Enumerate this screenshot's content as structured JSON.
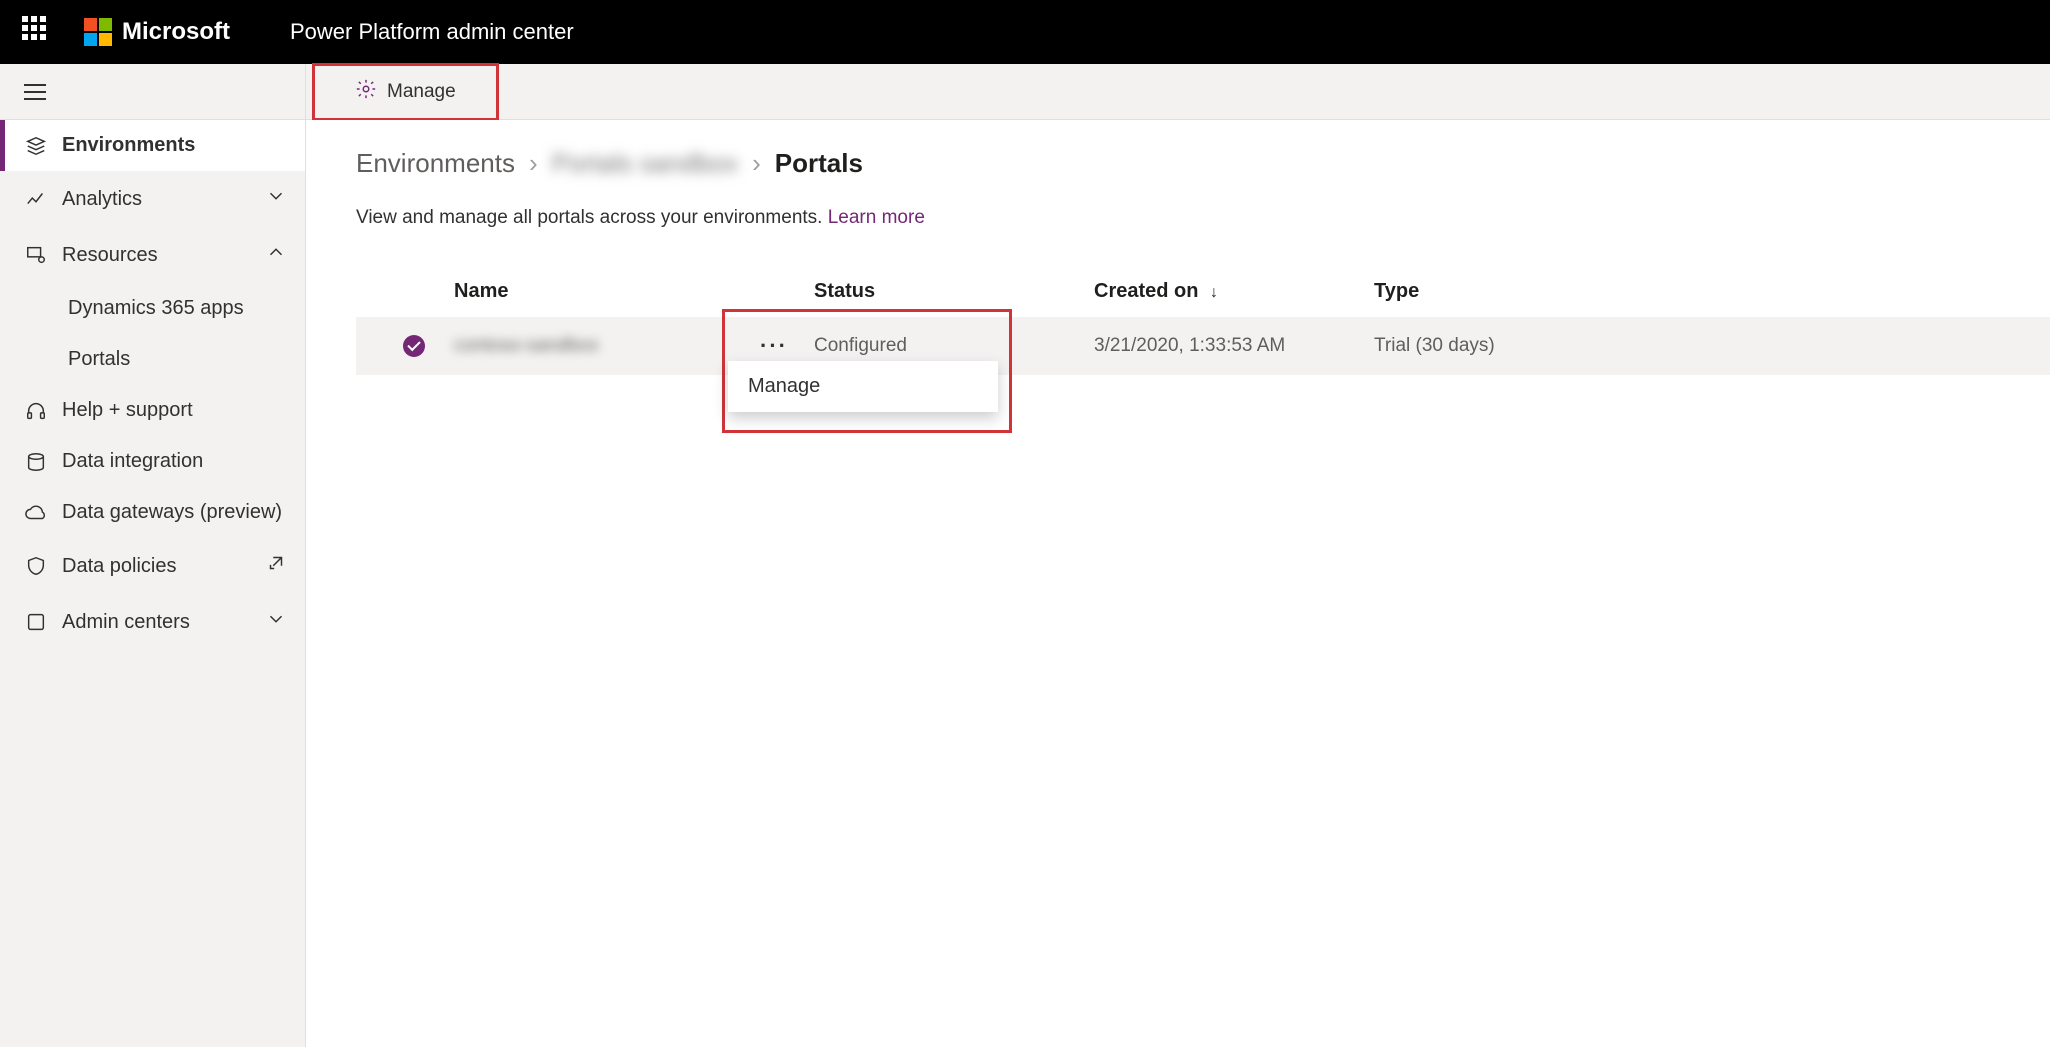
{
  "topbar": {
    "brand": "Microsoft",
    "app_title": "Power Platform admin center"
  },
  "sidebar": {
    "items": [
      {
        "label": "Environments"
      },
      {
        "label": "Analytics"
      },
      {
        "label": "Resources"
      },
      {
        "label": "Dynamics 365 apps"
      },
      {
        "label": "Portals"
      },
      {
        "label": "Help + support"
      },
      {
        "label": "Data integration"
      },
      {
        "label": "Data gateways (preview)"
      },
      {
        "label": "Data policies"
      },
      {
        "label": "Admin centers"
      }
    ]
  },
  "commandbar": {
    "manage": "Manage"
  },
  "breadcrumb": {
    "root": "Environments",
    "env": "Portals sandbox",
    "current": "Portals"
  },
  "description": {
    "text": "View and manage all portals across your environments. ",
    "link": "Learn more"
  },
  "table": {
    "headers": {
      "name": "Name",
      "status": "Status",
      "created": "Created on",
      "type": "Type"
    },
    "rows": [
      {
        "name": "contoso-sandbox",
        "status": "Configured",
        "created": "3/21/2020, 1:33:53 AM",
        "type": "Trial (30 days)"
      }
    ]
  },
  "context_menu": {
    "manage": "Manage"
  }
}
